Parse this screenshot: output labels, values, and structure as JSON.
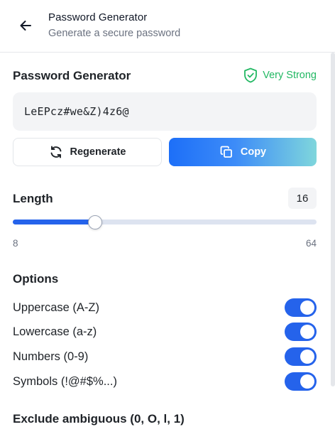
{
  "header": {
    "title": "Password Generator",
    "subtitle": "Generate a secure password"
  },
  "generator": {
    "title": "Password Generator",
    "strength_label": "Very Strong",
    "password": "LeEPcz#we&Z)4z6@",
    "regenerate_label": "Regenerate",
    "copy_label": "Copy"
  },
  "length": {
    "title": "Length",
    "value": "16",
    "min": "8",
    "max": "64",
    "current": 16,
    "min_value": 8,
    "max_value": 64
  },
  "options": {
    "title": "Options",
    "items": [
      {
        "label": "Uppercase (A-Z)",
        "enabled": true
      },
      {
        "label": "Lowercase (a-z)",
        "enabled": true
      },
      {
        "label": "Numbers (0-9)",
        "enabled": true
      },
      {
        "label": "Symbols (!@#$%...)",
        "enabled": true
      }
    ]
  },
  "exclude": {
    "title": "Exclude ambiguous (0, O, l, 1)"
  },
  "colors": {
    "accent": "#2563eb",
    "strength": "#22b863",
    "copy_gradient_start": "#1d6ff8",
    "copy_gradient_end": "#7fd6dc"
  },
  "icons": {
    "back": "arrow-left-icon",
    "strength": "shield-check-icon",
    "regenerate": "refresh-icon",
    "copy": "copy-icon"
  }
}
